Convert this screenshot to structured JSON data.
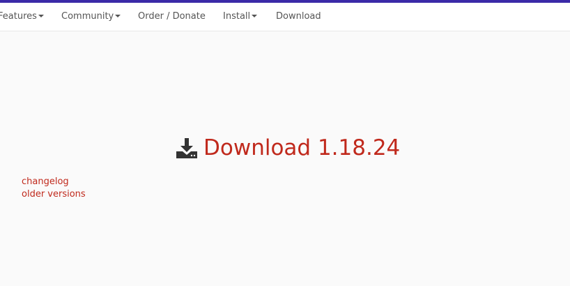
{
  "colors": {
    "accent_bar": "#3b2aa8",
    "link_red": "#c0291c",
    "nav_text": "#555555",
    "background": "#fafafa"
  },
  "nav": {
    "features": "Features",
    "community": "Community",
    "order_donate": "Order / Donate",
    "install": "Install",
    "download": "Download"
  },
  "main": {
    "download_icon": "download-to-drive-icon",
    "download_label": "Download 1.18.24",
    "links": {
      "changelog": "changelog",
      "older_versions": "older versions"
    }
  }
}
